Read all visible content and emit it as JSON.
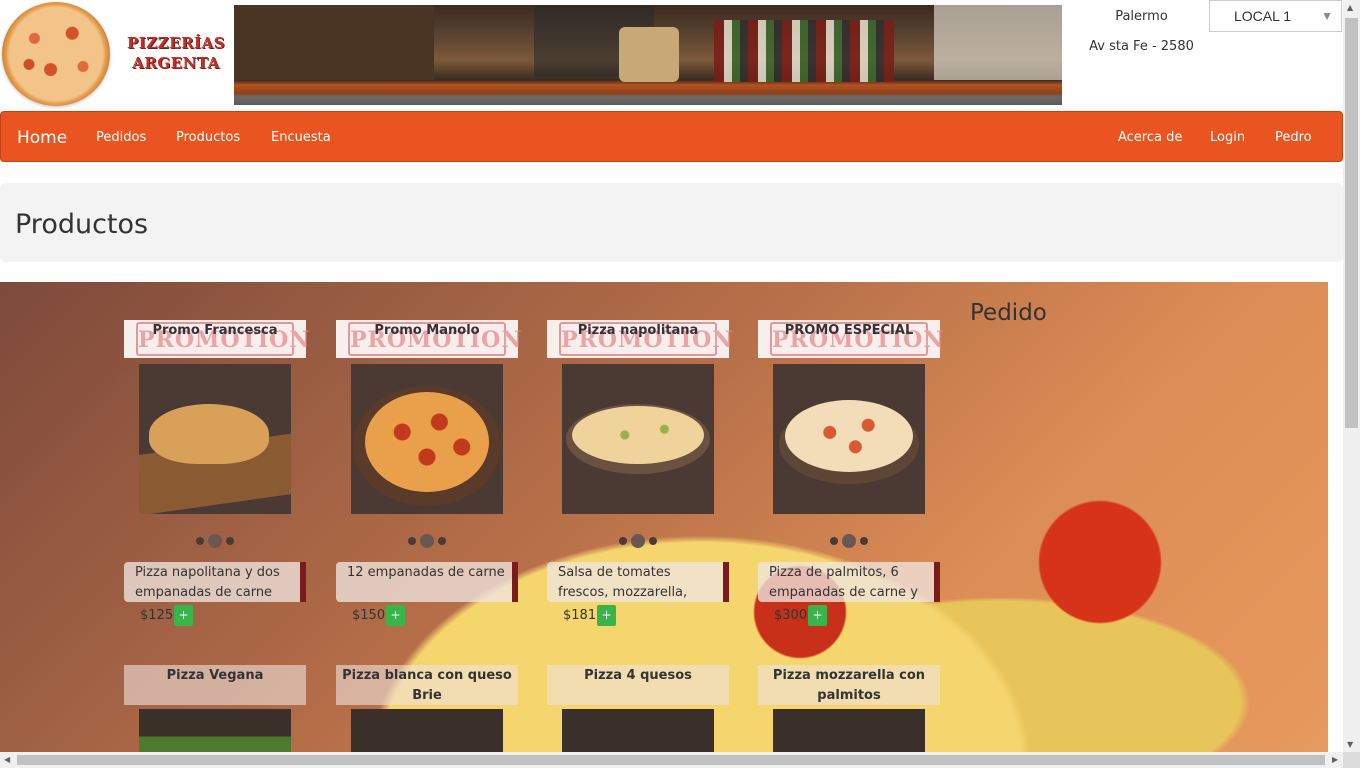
{
  "header": {
    "logo_text_line1": "PIZZERÍAS",
    "logo_text_line2": "ARGENTA",
    "location_city": "Palermo",
    "location_address": "Av sta Fe - 2580",
    "local_select": "LOCAL 1"
  },
  "navbar": {
    "brand": "Home",
    "left_items": [
      "Pedidos",
      "Productos",
      "Encuesta"
    ],
    "right_items": [
      "Acerca de",
      "Login",
      "Pedro"
    ],
    "color": "#e95420"
  },
  "page": {
    "title": "Productos",
    "order_title": "Pedido"
  },
  "products": [
    {
      "promo_stamp": "PROMOTION",
      "title": "Promo Francesca",
      "description": "Pizza napolitana y dos empanadas de carne",
      "price": "$125",
      "add_label": "+"
    },
    {
      "promo_stamp": "PROMOTION",
      "title": "Promo Manolo",
      "description": "12 empanadas de carne",
      "price": "$150",
      "add_label": "+"
    },
    {
      "promo_stamp": "PROMOTION",
      "title": "Pizza napolitana",
      "description": "Salsa de tomates frescos, mozzarella, oregano y",
      "price": "$181",
      "add_label": "+"
    },
    {
      "promo_stamp": "PROMOTION",
      "title": "PROMO ESPECIAL",
      "description": "Pizza de palmitos, 6 empanadas de carne y",
      "price": "$300",
      "add_label": "+"
    }
  ],
  "products_row2": [
    {
      "title": "Pizza Vegana"
    },
    {
      "title": "Pizza blanca con queso Brie"
    },
    {
      "title": "Pizza 4 quesos"
    },
    {
      "title": "Pizza mozzarella con palmitos"
    }
  ],
  "icons": {
    "dropdown": "chevron-down-icon",
    "add": "plus-icon"
  }
}
